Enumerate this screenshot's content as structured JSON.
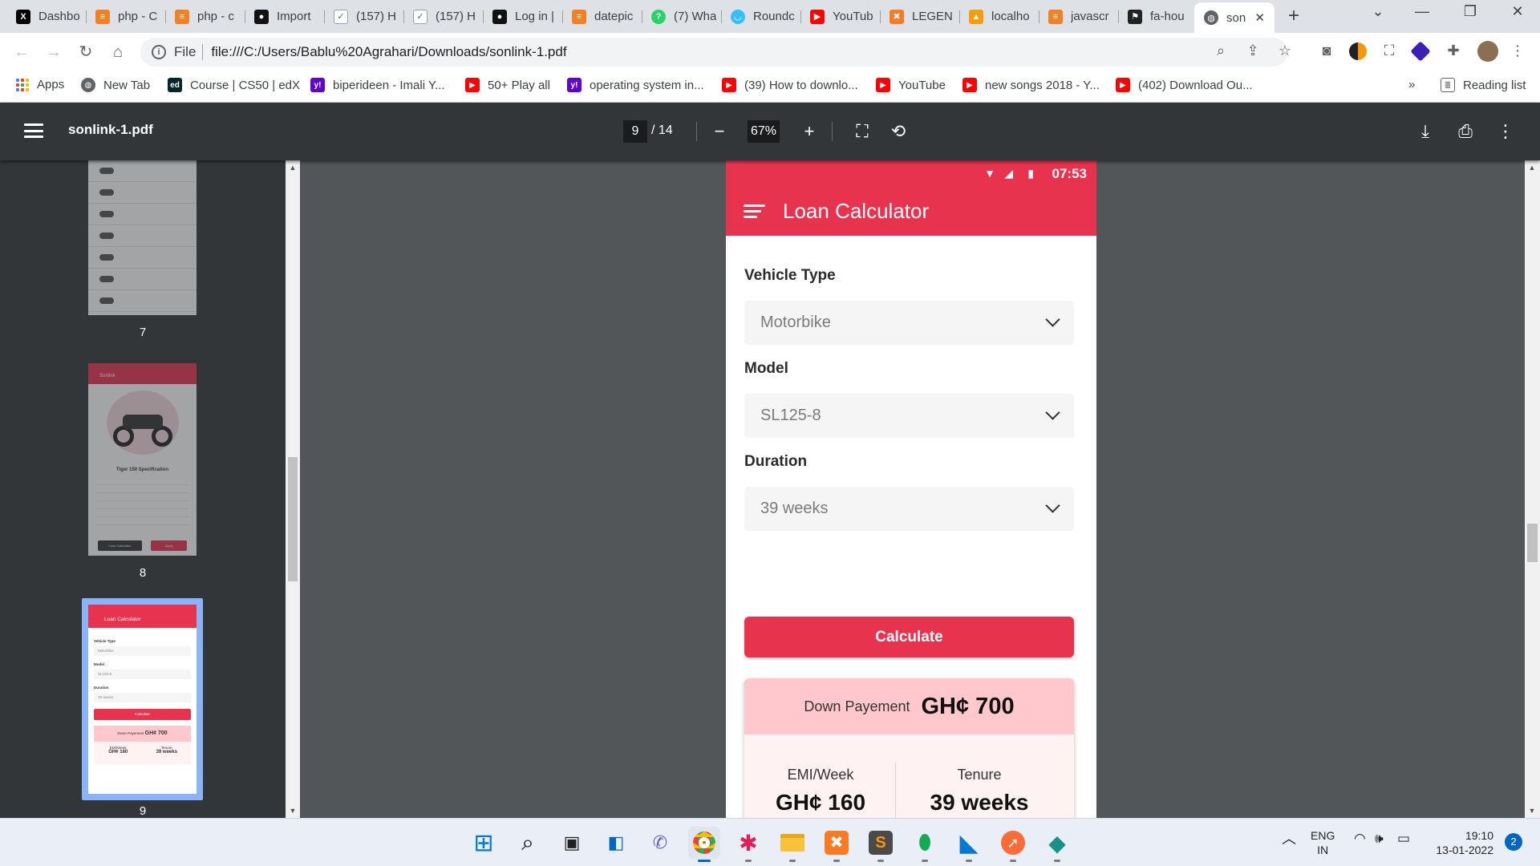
{
  "browser": {
    "tabs": [
      {
        "label": "Dashbo",
        "icon": "x-logo-icon",
        "color": "#000000"
      },
      {
        "label": "php - C",
        "icon": "stackoverflow-icon",
        "color": "#f48024"
      },
      {
        "label": "php - c",
        "icon": "stackoverflow-icon",
        "color": "#f48024"
      },
      {
        "label": "Import",
        "icon": "mongodb-icon",
        "color": "#13aa52"
      },
      {
        "label": "(157) H",
        "icon": "checkmark-icon",
        "color": "#5f6368"
      },
      {
        "label": "(157) H",
        "icon": "checkmark-icon",
        "color": "#5f6368"
      },
      {
        "label": "Log in |",
        "icon": "mongodb-icon",
        "color": "#13aa52"
      },
      {
        "label": "datepic",
        "icon": "stackoverflow-icon",
        "color": "#f48024"
      },
      {
        "label": "(7) Wha",
        "icon": "whatsapp-icon",
        "color": "#25d366"
      },
      {
        "label": "Roundc",
        "icon": "roundcube-icon",
        "color": "#37beff"
      },
      {
        "label": "YouTub",
        "icon": "youtube-icon",
        "color": "#ff0000"
      },
      {
        "label": "LEGEN",
        "icon": "xampp-icon",
        "color": "#fb7a24"
      },
      {
        "label": "localho",
        "icon": "phpmyadmin-icon",
        "color": "#f89c0e"
      },
      {
        "label": "javascr",
        "icon": "stackoverflow-icon",
        "color": "#f48024"
      },
      {
        "label": "fa-hou",
        "icon": "fontawesome-icon",
        "color": "#222222"
      },
      {
        "label": "son",
        "icon": "globe-icon",
        "color": "#5f6368",
        "active": true
      }
    ],
    "tab_close": "✕",
    "new_tab": "+",
    "address": {
      "scheme": "File",
      "url": "file:///C:/Users/Bablu%20Agrahari/Downloads/sonlink-1.pdf"
    },
    "bookmarks": [
      {
        "label": "Apps",
        "icon": "apps-grid-icon",
        "color": "#4285f4"
      },
      {
        "label": "New Tab",
        "icon": "globe-icon",
        "color": "#5f6368"
      },
      {
        "label": "Course | CS50 | edX",
        "icon": "edx-icon",
        "color": "#02262b"
      },
      {
        "label": "biperideen - Imali Y...",
        "icon": "yahoo-icon",
        "color": "#6001d2"
      },
      {
        "label": "50+ Play all",
        "icon": "youtube-icon",
        "color": "#ff0000"
      },
      {
        "label": "operating system in...",
        "icon": "yahoo-icon",
        "color": "#6001d2"
      },
      {
        "label": "(39) How to downlo...",
        "icon": "youtube-icon",
        "color": "#ff0000"
      },
      {
        "label": "YouTube",
        "icon": "youtube-icon",
        "color": "#ff0000"
      },
      {
        "label": "new songs 2018 - Y...",
        "icon": "youtube-icon",
        "color": "#ff0000"
      },
      {
        "label": "(402) Download Ou...",
        "icon": "youtube-icon",
        "color": "#ff0000"
      }
    ],
    "bookmarks_overflow": "»",
    "reading_list": "Reading list"
  },
  "pdf": {
    "title": "sonlink-1.pdf",
    "current_page": "9",
    "total_pages": "/ 14",
    "zoom": "67%",
    "thumbnails": [
      {
        "num": "7",
        "page": 7
      },
      {
        "num": "8",
        "page": 8
      },
      {
        "num": "9",
        "page": 9,
        "selected": true
      }
    ]
  },
  "thumb8": {
    "header": "Sonlink",
    "spec_title": "Tiger 150 Specification",
    "btn1": "Loan Calculator",
    "btn2": "Apply"
  },
  "thumb9": {
    "header": "Loan Calculator",
    "v1": "Vehicle Type",
    "o1": "Motorbike",
    "v2": "Model",
    "o2": "SL125-8",
    "v3": "Duration",
    "o3": "39 weeks",
    "calc": "Calculate",
    "down": "Down Payement",
    "down_v": "GH¢ 700",
    "emi": "EMI/Week",
    "emi_v": "GH¢ 160",
    "ten": "Tenure",
    "ten_v": "39 weeks"
  },
  "app": {
    "status_time": "07:53",
    "title": "Loan Calculator",
    "vehicle_type_label": "Vehicle Type",
    "vehicle_type_value": "Motorbike",
    "model_label": "Model",
    "model_value": "SL125-8",
    "duration_label": "Duration",
    "duration_value": "39 weeks",
    "calculate_label": "Calculate",
    "down_payment_label": "Down Payement",
    "down_payment_value": "GH¢ 700",
    "emi_label": "EMI/Week",
    "emi_value": "GH¢ 160",
    "tenure_label": "Tenure",
    "tenure_value": "39 weeks",
    "accent_color": "#e8334f",
    "highlight_color": "#ffc8cc"
  },
  "taskbar": {
    "apps": [
      {
        "name": "windows-start",
        "icon": "⊞"
      },
      {
        "name": "search",
        "icon": "⌕"
      },
      {
        "name": "task-view",
        "icon": "▣"
      },
      {
        "name": "widgets",
        "icon": "◧"
      },
      {
        "name": "teams-chat",
        "icon": "✆"
      },
      {
        "name": "chrome",
        "icon": "◉",
        "active": true
      },
      {
        "name": "slack",
        "icon": "✱"
      },
      {
        "name": "file-explorer",
        "icon": "▬"
      },
      {
        "name": "xampp",
        "icon": "✖"
      },
      {
        "name": "sublime-text",
        "icon": "S"
      },
      {
        "name": "mongodb-compass",
        "icon": "⬮"
      },
      {
        "name": "vscode",
        "icon": "◣"
      },
      {
        "name": "postman",
        "icon": "➚"
      },
      {
        "name": "git-kraken",
        "icon": "◆"
      }
    ],
    "lang_top": "ENG",
    "lang_bottom": "IN",
    "time": "19:10",
    "date": "13-01-2022",
    "notifications": "2"
  }
}
